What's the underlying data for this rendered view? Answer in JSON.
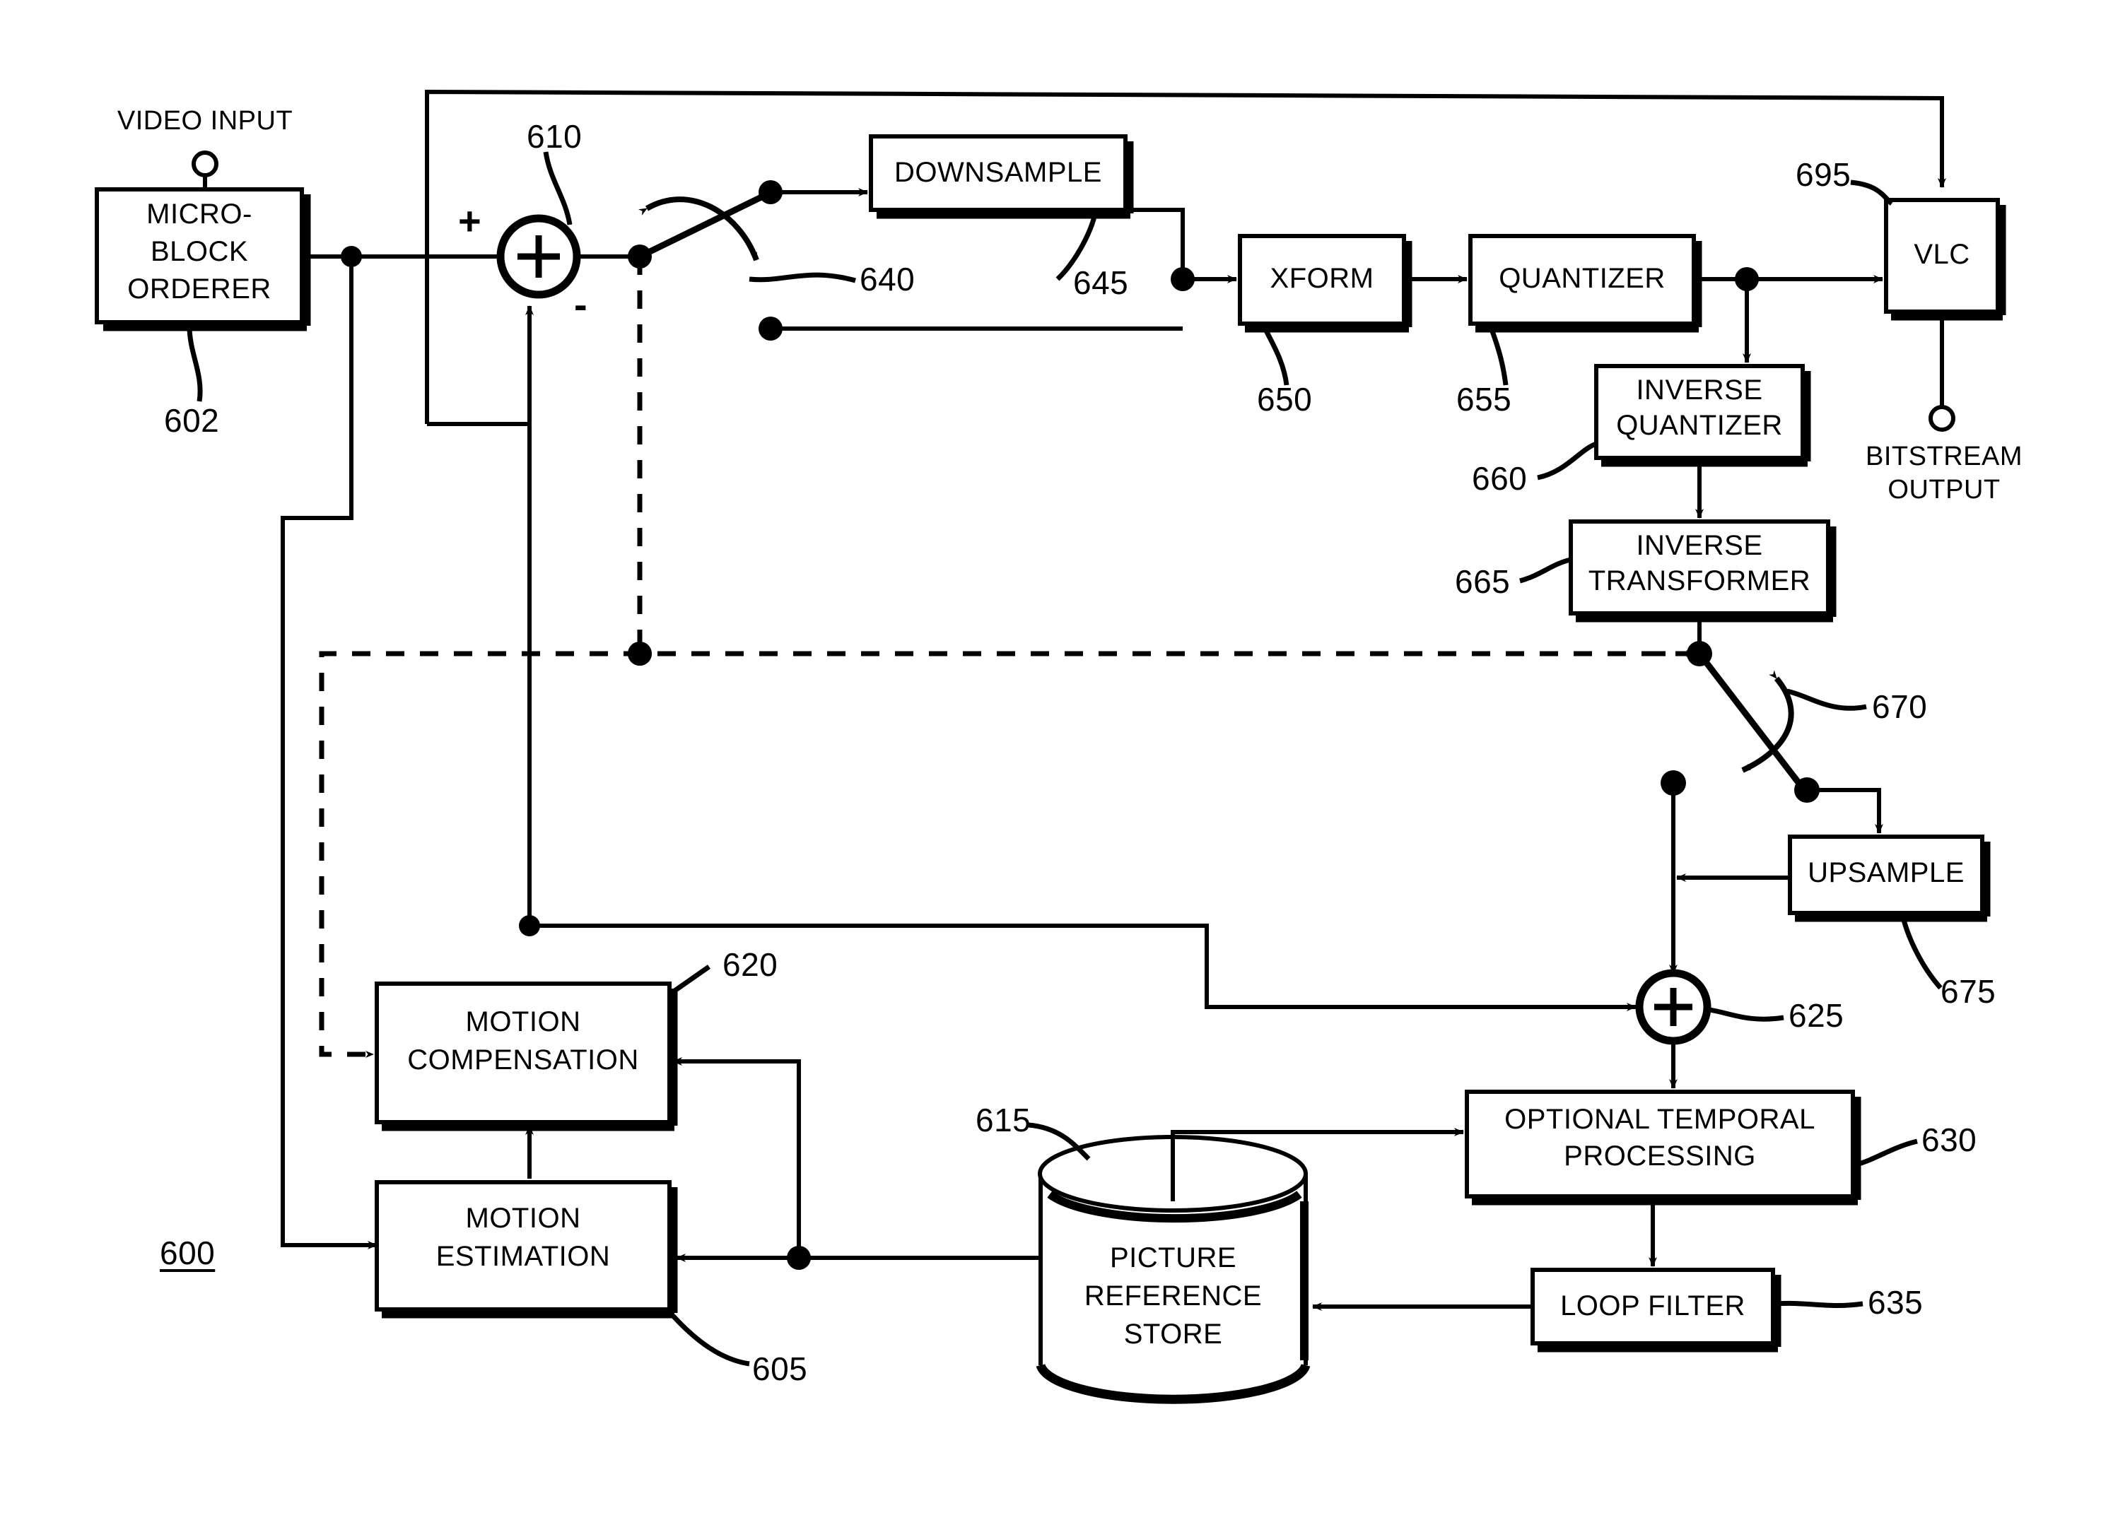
{
  "figure": {
    "number": "600",
    "title_note": "video encoder block diagram"
  },
  "io_ports": [
    {
      "name": "video-input-port",
      "label": "VIDEO INPUT"
    },
    {
      "name": "bitstream-output-port",
      "label": "BITSTREAM\nOUTPUT"
    }
  ],
  "blocks": [
    {
      "id": "micro-block-orderer",
      "label": "MICRO-\nBLOCK\nORDERER",
      "ref": "602",
      "shape": "rect"
    },
    {
      "id": "downsample",
      "label": "DOWNSAMPLE",
      "ref": "645",
      "shape": "rect"
    },
    {
      "id": "xform",
      "label": "XFORM",
      "ref": "650",
      "shape": "rect"
    },
    {
      "id": "quantizer",
      "label": "QUANTIZER",
      "ref": "655",
      "shape": "rect"
    },
    {
      "id": "vlc",
      "label": "VLC",
      "ref": "695",
      "shape": "rect"
    },
    {
      "id": "inverse-quantizer",
      "label": "INVERSE\nQUANTIZER",
      "ref": "660",
      "shape": "rect"
    },
    {
      "id": "inverse-transformer",
      "label": "INVERSE\nTRANSFORMER",
      "ref": "665",
      "shape": "rect"
    },
    {
      "id": "upsample",
      "label": "UPSAMPLE",
      "ref": "675",
      "shape": "rect"
    },
    {
      "id": "optional-temporal-processing",
      "label": "OPTIONAL TEMPORAL\nPROCESSING",
      "ref": "630",
      "shape": "rect"
    },
    {
      "id": "loop-filter",
      "label": "LOOP FILTER",
      "ref": "635",
      "shape": "rect"
    },
    {
      "id": "motion-compensation",
      "label": "MOTION\nCOMPENSATION",
      "ref": "620",
      "shape": "rect"
    },
    {
      "id": "motion-estimation",
      "label": "MOTION\nESTIMATION",
      "ref": "605",
      "shape": "rect"
    },
    {
      "id": "picture-reference-store",
      "label": "PICTURE\nREFERENCE\nSTORE",
      "ref": "615",
      "shape": "cylinder"
    }
  ],
  "adders": [
    {
      "id": "adder-610",
      "ref": "610",
      "glyph": "+",
      "plus_sign": "+",
      "minus_sign": "-"
    },
    {
      "id": "adder-625",
      "ref": "625",
      "glyph": "+"
    }
  ],
  "switches": [
    {
      "id": "switch-640",
      "ref": "640"
    },
    {
      "id": "switch-670",
      "ref": "670"
    }
  ],
  "ref_labels": {
    "r600": "600",
    "r602": "602",
    "r605": "605",
    "r610": "610",
    "r615": "615",
    "r620": "620",
    "r625": "625",
    "r630": "630",
    "r635": "635",
    "r640": "640",
    "r645": "645",
    "r650": "650",
    "r655": "655",
    "r660": "660",
    "r665": "665",
    "r670": "670",
    "r675": "675",
    "r695": "695"
  },
  "block_labels": {
    "micro_block_orderer_l1": "MICRO-",
    "micro_block_orderer_l2": "BLOCK",
    "micro_block_orderer_l3": "ORDERER",
    "downsample": "DOWNSAMPLE",
    "xform": "XFORM",
    "quantizer": "QUANTIZER",
    "vlc": "VLC",
    "inverse_quantizer_l1": "INVERSE",
    "inverse_quantizer_l2": "QUANTIZER",
    "inverse_transformer_l1": "INVERSE",
    "inverse_transformer_l2": "TRANSFORMER",
    "upsample": "UPSAMPLE",
    "otp_l1": "OPTIONAL TEMPORAL",
    "otp_l2": "PROCESSING",
    "loop_filter": "LOOP FILTER",
    "motion_compensation_l1": "MOTION",
    "motion_compensation_l2": "COMPENSATION",
    "motion_estimation_l1": "MOTION",
    "motion_estimation_l2": "ESTIMATION",
    "prs_l1": "PICTURE",
    "prs_l2": "REFERENCE",
    "prs_l3": "STORE"
  },
  "port_labels": {
    "video_input": "VIDEO INPUT",
    "bitstream_output_l1": "BITSTREAM",
    "bitstream_output_l2": "OUTPUT"
  },
  "signs": {
    "plus": "+",
    "minus": "-",
    "adder_610_glyph": "+",
    "adder_625_glyph": "+"
  },
  "colors": {
    "ink": "#000000",
    "paper": "#ffffff"
  }
}
